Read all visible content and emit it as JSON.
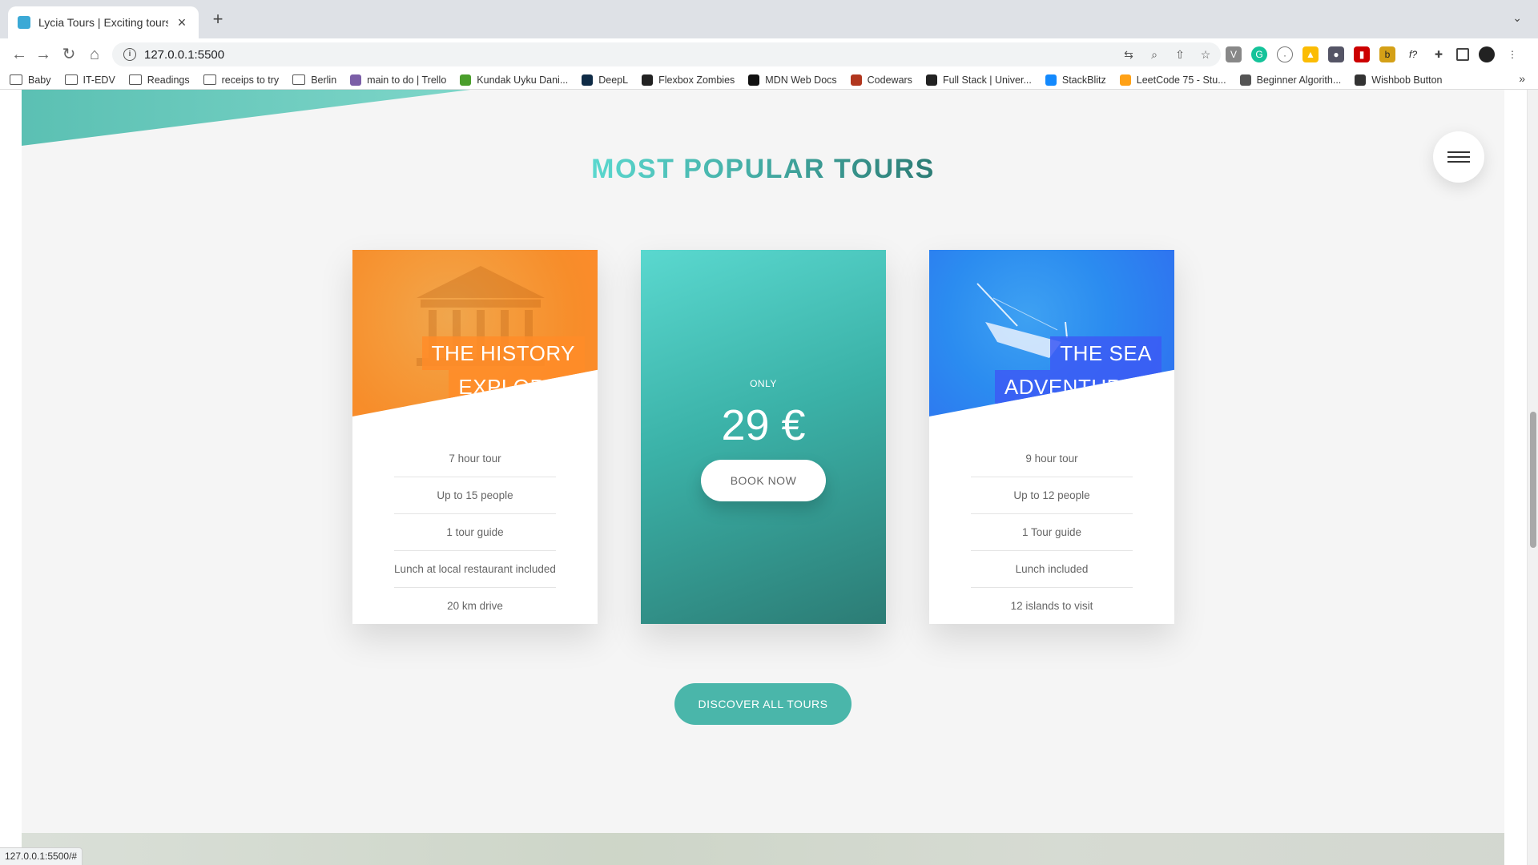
{
  "browser": {
    "tab_title": "Lycia Tours | Exciting tours for",
    "url": "127.0.0.1:5500",
    "bookmarks": [
      {
        "label": "Baby",
        "type": "folder"
      },
      {
        "label": "IT-EDV",
        "type": "folder"
      },
      {
        "label": "Readings",
        "type": "folder"
      },
      {
        "label": "receips to try",
        "type": "folder"
      },
      {
        "label": "Berlin",
        "type": "folder"
      },
      {
        "label": "main to do | Trello",
        "type": "site",
        "color": "#7b5ea7"
      },
      {
        "label": "Kundak Uyku Dani...",
        "type": "site",
        "color": "#4a9e2b"
      },
      {
        "label": "DeepL",
        "type": "site",
        "color": "#0f2b46"
      },
      {
        "label": "Flexbox Zombies",
        "type": "site",
        "color": "#222222"
      },
      {
        "label": "MDN Web Docs",
        "type": "site",
        "color": "#111111"
      },
      {
        "label": "Codewars",
        "type": "site",
        "color": "#b1361e"
      },
      {
        "label": "Full Stack | Univer...",
        "type": "site",
        "color": "#222222"
      },
      {
        "label": "StackBlitz",
        "type": "site",
        "color": "#1389fd"
      },
      {
        "label": "LeetCode 75 - Stu...",
        "type": "site",
        "color": "#ffa116"
      },
      {
        "label": "Beginner Algorith...",
        "type": "site",
        "color": "#555555"
      },
      {
        "label": "Wishbob Button",
        "type": "site",
        "color": "#333333"
      }
    ],
    "status_url": "127.0.0.1:5500/#"
  },
  "page": {
    "section_title": "MOST POPULAR TOURS",
    "tours": [
      {
        "title_line1": "THE HISTORY",
        "title_line2": "EXPLORER",
        "features": [
          "7 hour tour",
          "Up to 15 people",
          "1 tour guide",
          "Lunch at local restaurant included",
          "20 km drive"
        ]
      },
      {
        "title_line1": "THE SEA",
        "title_line2": "ADVENTURER",
        "features": [
          "9 hour tour",
          "Up to 12 people",
          "1 Tour guide",
          "Lunch included",
          "12 islands to visit"
        ]
      }
    ],
    "price": {
      "only_label": "ONLY",
      "value": "29 €",
      "book_label": "BOOK NOW"
    },
    "discover_label": "DISCOVER ALL TOURS"
  },
  "colors": {
    "primary": "#55c57a",
    "teal_light": "#5ad8cf",
    "teal_dark": "#2c7c75",
    "orange": "#ff8a2b",
    "blue": "#2f6ff0"
  }
}
